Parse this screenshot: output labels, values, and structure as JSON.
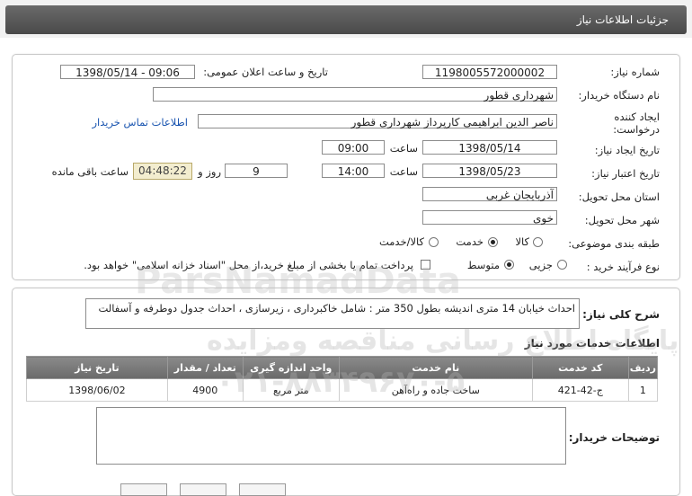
{
  "header": {
    "title": "جزئیات اطلاعات نیاز"
  },
  "form": {
    "need_number_label": "شماره نیاز:",
    "need_number": "1198005572000002",
    "announce_label": "تاریخ و ساعت اعلان عمومی:",
    "announce_value": "1398/05/14 - 09:06",
    "buyer_org_label": "نام دستگاه خریدار:",
    "buyer_org": "شهرداری قطور",
    "creator_label_1": "ایجاد کننده",
    "creator_label_2": "درخواست:",
    "creator_value": "ناصر الدین ابراهیمی کارپرداز شهرداری قطور",
    "contact_link": "اطلاعات تماس خریدار",
    "create_date_label": "تاریخ ایجاد نیاز:",
    "create_date": "1398/05/14",
    "time_label": "ساعت",
    "create_time": "09:00",
    "validity_label": "تاریخ اعتبار نیاز:",
    "validity_date": "1398/05/23",
    "validity_time": "14:00",
    "days_value": "9",
    "days_label": "روز و",
    "remaining_time": "04:48:22",
    "remaining_label": "ساعت باقی مانده",
    "province_label": "استان محل تحویل:",
    "province": "آذربایجان غربی",
    "city_label": "شهر محل تحویل:",
    "city": "خوی",
    "category_label": "طبقه بندی موضوعی:",
    "category_options": [
      "کالا",
      "خدمت",
      "کالا/خدمت"
    ],
    "category_selected": "خدمت",
    "process_label": "نوع فرآیند خرید :",
    "process_options": [
      "جزیی",
      "متوسط"
    ],
    "process_selected": "متوسط",
    "treasury_text": "پرداخت تمام یا بخشی از مبلغ خرید،از محل \"اسناد خزانه اسلامی\" خواهد بود."
  },
  "description": {
    "label": "شرح کلی نیاز:",
    "text": "احداث خیابان 14 متری اندیشه بطول 350 متر : شامل خاکبرداری ، زیرسازی ، احداث جدول دوطرفه و آسفالت"
  },
  "services": {
    "section_title": "اطلاعات خدمات مورد نیاز",
    "columns": [
      "ردیف",
      "کد خدمت",
      "نام خدمت",
      "واحد اندازه گیری",
      "تعداد / مقدار",
      "تاریخ نیاز"
    ],
    "rows": [
      [
        "1",
        "ج-42-421",
        "ساخت جاده و راه‌آهن",
        "متر مربع",
        "4900",
        "1398/06/02"
      ]
    ]
  },
  "buyer_notes": {
    "label": "توضیحات خریدار:",
    "value": ""
  },
  "watermark": {
    "line1": "پایگاه اطلاع رسانی مناقصه ومزایده",
    "line2": "ParsNamadData",
    "line3": "۰۲۱-۸۸۳۴۹۶۷۰-۵"
  }
}
